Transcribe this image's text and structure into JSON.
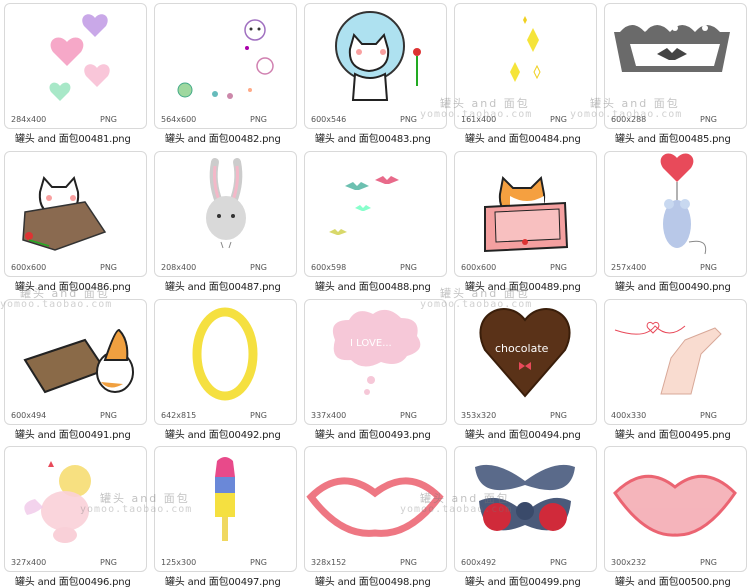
{
  "grid": {
    "items": [
      {
        "dims": "284x400",
        "fmt": "PNG",
        "name": "罐头 and 面包00481.png",
        "art": "hearts"
      },
      {
        "dims": "564x600",
        "fmt": "PNG",
        "name": "罐头 and 面包00482.png",
        "art": "kitty-bunny-frog"
      },
      {
        "dims": "600x546",
        "fmt": "PNG",
        "name": "罐头 and 面包00483.png",
        "art": "cat-astronaut"
      },
      {
        "dims": "161x400",
        "fmt": "PNG",
        "name": "罐头 and 面包00484.png",
        "art": "sparkles"
      },
      {
        "dims": "600x288",
        "fmt": "PNG",
        "name": "罐头 and 面包00485.png",
        "art": "bat-crown"
      },
      {
        "dims": "600x600",
        "fmt": "PNG",
        "name": "罐头 and 面包00486.png",
        "art": "cat-rock"
      },
      {
        "dims": "208x400",
        "fmt": "PNG",
        "name": "罐头 and 面包00487.png",
        "art": "rabbit"
      },
      {
        "dims": "600x598",
        "fmt": "PNG",
        "name": "罐头 and 面包00488.png",
        "art": "bats"
      },
      {
        "dims": "600x600",
        "fmt": "PNG",
        "name": "罐头 and 面包00489.png",
        "art": "cat-box"
      },
      {
        "dims": "257x400",
        "fmt": "PNG",
        "name": "罐头 and 面包00490.png",
        "art": "mouse-balloon"
      },
      {
        "dims": "600x494",
        "fmt": "PNG",
        "name": "罐头 and 面包00491.png",
        "art": "cat-bag"
      },
      {
        "dims": "642x815",
        "fmt": "PNG",
        "name": "罐头 and 面包00492.png",
        "art": "yellow-ring"
      },
      {
        "dims": "337x400",
        "fmt": "PNG",
        "name": "罐头 and 面包00493.png",
        "art": "cloud-love"
      },
      {
        "dims": "353x320",
        "fmt": "PNG",
        "name": "罐头 and 面包00494.png",
        "art": "chocolate"
      },
      {
        "dims": "400x330",
        "fmt": "PNG",
        "name": "罐头 and 面包00495.png",
        "art": "hand-string"
      },
      {
        "dims": "327x400",
        "fmt": "PNG",
        "name": "罐头 and 面包00496.png",
        "art": "pig-angel"
      },
      {
        "dims": "125x300",
        "fmt": "PNG",
        "name": "罐头 and 面包00497.png",
        "art": "popsicle"
      },
      {
        "dims": "328x152",
        "fmt": "PNG",
        "name": "罐头 and 面包00498.png",
        "art": "lips-open"
      },
      {
        "dims": "600x492",
        "fmt": "PNG",
        "name": "罐头 and 面包00499.png",
        "art": "bow"
      },
      {
        "dims": "300x232",
        "fmt": "PNG",
        "name": "罐头 and 面包00500.png",
        "art": "lips-closed"
      }
    ]
  },
  "watermark": {
    "cn": "罐头 and 面包",
    "en": "yomoo.taobao.com"
  },
  "colors": {
    "tile_border": "#d9d9d9",
    "text": "#222222"
  }
}
